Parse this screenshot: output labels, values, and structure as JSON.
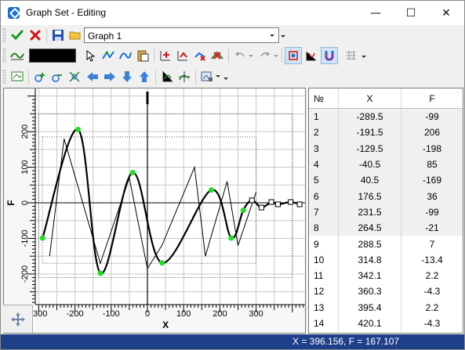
{
  "window": {
    "title": "Graph Set - Editing",
    "minimize_glyph": "—",
    "maximize_glyph": "☐",
    "close_glyph": "✕"
  },
  "toolbar1": {
    "graph_select_value": "Graph 1",
    "icons": [
      "check-icon",
      "cancel-icon",
      "save-icon",
      "open-folder-icon"
    ]
  },
  "toolbar2": {
    "line_color": "#000000",
    "icons": [
      "line-style-icon",
      "select-pointer-icon",
      "move-points-icon",
      "smooth-icon",
      "paste-icon",
      "add-point-icon",
      "insert-point-icon",
      "delete-point-icon",
      "clear-points-icon",
      "undo-icon",
      "redo-icon",
      "snap-to-point-icon",
      "snap-to-grid-icon",
      "magnet-icon",
      "grid-settings-icon"
    ]
  },
  "toolbar3": {
    "icons": [
      "fit-all-icon",
      "zoom-in-icon",
      "zoom-out-icon",
      "zoom-window-icon",
      "pan-left-icon",
      "pan-right-icon",
      "pan-down-icon",
      "pan-up-icon",
      "axis-scale-icon",
      "axis-origin-icon",
      "background-image-icon"
    ]
  },
  "plot": {
    "x_axis_label": "X",
    "y_axis_label": "F",
    "x_ticks": [
      "-300",
      "-200",
      "-100",
      "0",
      "100",
      "200",
      "300"
    ],
    "y_ticks": [
      "200",
      "100",
      "0",
      "-100",
      "-200"
    ]
  },
  "table": {
    "headers": [
      "№",
      "X",
      "F"
    ],
    "rows": [
      [
        "1",
        "-289.5",
        "-99"
      ],
      [
        "2",
        "-191.5",
        "206"
      ],
      [
        "3",
        "-129.5",
        "-198"
      ],
      [
        "4",
        "-40.5",
        "85"
      ],
      [
        "5",
        "40.5",
        "-169"
      ],
      [
        "6",
        "176.5",
        "36"
      ],
      [
        "7",
        "231.5",
        "-99"
      ],
      [
        "8",
        "264.5",
        "-21"
      ],
      [
        "9",
        "288.5",
        "7"
      ],
      [
        "10",
        "314.8",
        "-13.4"
      ],
      [
        "11",
        "342.1",
        "2.2"
      ],
      [
        "12",
        "360.3",
        "-4.3"
      ],
      [
        "13",
        "395.4",
        "2.2"
      ],
      [
        "14",
        "420.1",
        "-4.3"
      ]
    ]
  },
  "status": {
    "text": "X = 396.156, F = 167.107"
  },
  "colors": {
    "status_bar": "#1e3f8a",
    "point_marker": "#22dd22",
    "row_shade": "#f0f0f0"
  }
}
